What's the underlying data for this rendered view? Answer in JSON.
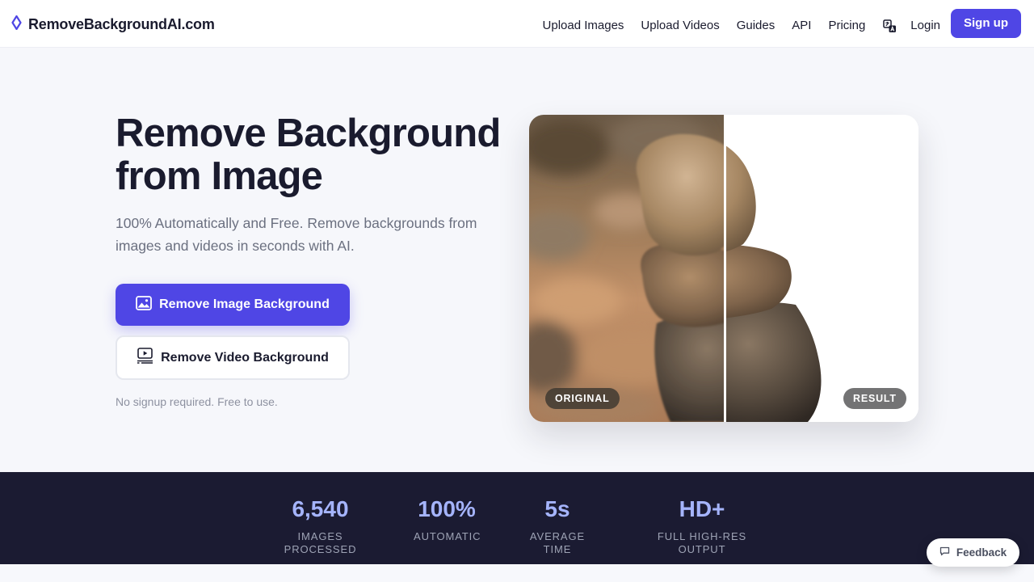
{
  "header": {
    "logo_text": "RemoveBackgroundAI.com",
    "nav": [
      "Upload Images",
      "Upload Videos",
      "Guides",
      "API",
      "Pricing"
    ],
    "login_label": "Login",
    "signup_label": "Sign up"
  },
  "hero": {
    "title_line1": "Remove Background",
    "title_line2": "from Image",
    "subtitle": "100% Automatically and Free. Remove backgrounds from images and videos in seconds with AI.",
    "primary_button": "Remove Image Background",
    "secondary_button": "Remove Video Background",
    "note": "No signup required. Free to use."
  },
  "compare": {
    "original_label": "ORIGINAL",
    "result_label": "RESULT"
  },
  "stats": [
    {
      "value": "6,540",
      "label": "IMAGES PROCESSED"
    },
    {
      "value": "100%",
      "label": "AUTOMATIC"
    },
    {
      "value": "5s",
      "label": "AVERAGE TIME"
    },
    {
      "value": "HD+",
      "label": "FULL HIGH-RES OUTPUT"
    }
  ],
  "feedback_label": "Feedback",
  "colors": {
    "accent": "#4f46e5",
    "stats_background": "#1b1b32",
    "stats_value": "#a5b4fc"
  },
  "icons": {
    "logo": "diamond-icon",
    "language": "translate-icon",
    "image": "image-icon",
    "video": "video-icon",
    "feedback": "chat-icon"
  }
}
